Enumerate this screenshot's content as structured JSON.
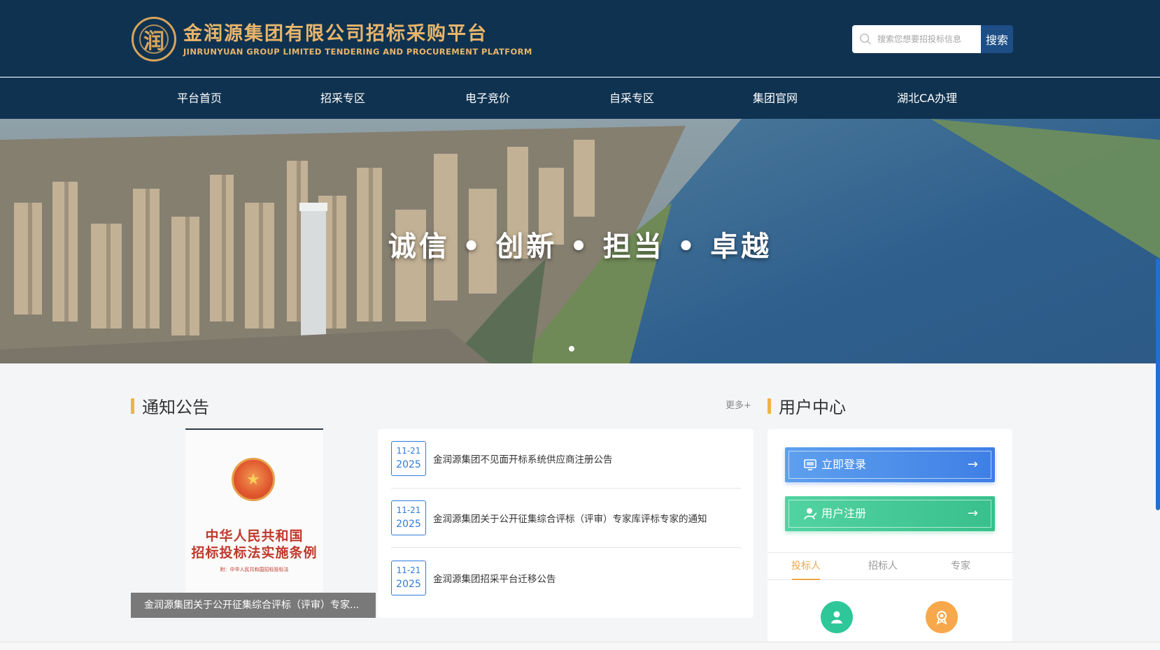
{
  "header": {
    "logo_mark": "润",
    "logo_cn": "金润源集团有限公司招标采购平台",
    "logo_en": "JINRUNYUAN GROUP LIMITED TENDERING AND PROCUREMENT PLATFORM",
    "search_placeholder": "搜索您想要招投标信息",
    "search_button": "搜索"
  },
  "nav": {
    "items": [
      {
        "label": "平台首页"
      },
      {
        "label": "招采专区"
      },
      {
        "label": "电子竞价"
      },
      {
        "label": "自采专区"
      },
      {
        "label": "集团官网"
      },
      {
        "label": "湖北CA办理"
      }
    ]
  },
  "banner": {
    "slogan": "诚信 • 创新 • 担当 • 卓越"
  },
  "notices": {
    "title": "通知公告",
    "more": "更多+",
    "image_caption": "金润源集团关于公开征集综合评标（评审）专家...",
    "image_text": {
      "title_line1": "中华人民共和国",
      "title_line2": "招标投标法实施条例",
      "subtitle": "附：中华人民共和国招标投标法"
    },
    "items": [
      {
        "month_day": "11-21",
        "year": "2025",
        "text": "金润源集团不见面开标系统供应商注册公告"
      },
      {
        "month_day": "11-21",
        "year": "2025",
        "text": "金润源集团关于公开征集综合评标（评审）专家库评标专家的通知"
      },
      {
        "month_day": "11-21",
        "year": "2025",
        "text": "金润源集团招采平台迁移公告"
      }
    ]
  },
  "user_center": {
    "title": "用户中心",
    "login": "立即登录",
    "register": "用户注册",
    "arrow": "→",
    "tabs": [
      {
        "label": "投标人",
        "active": true
      },
      {
        "label": "招标人",
        "active": false
      },
      {
        "label": "专家",
        "active": false
      }
    ]
  },
  "colors": {
    "header_bg": "#0f3250",
    "accent_gold": "#e8b56b",
    "section_bar": "#f0b24a",
    "date_blue": "#2f7bd8",
    "login_blue": "#3e7fe5",
    "register_green": "#38c08c"
  }
}
